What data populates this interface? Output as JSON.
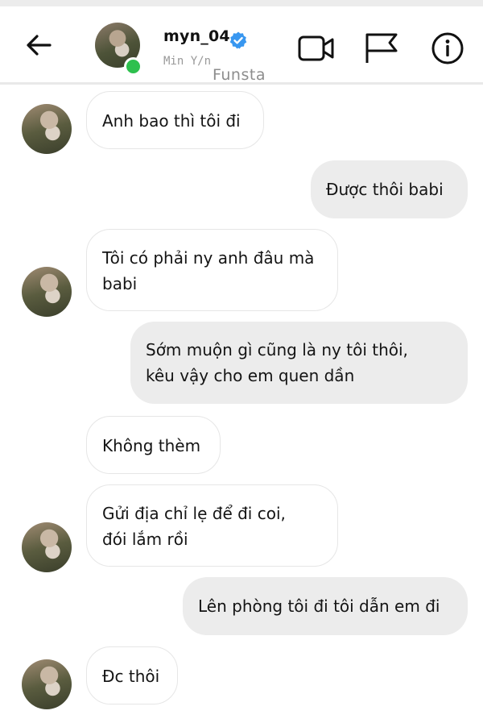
{
  "header": {
    "username": "myn_04",
    "subtitle": "Min Y/n",
    "watermark": "Funsta",
    "icons": {
      "back": "arrow-left-icon",
      "verified": "verified-badge-icon",
      "video": "video-call-icon",
      "flag": "flag-icon",
      "info": "info-icon"
    },
    "colors": {
      "verified": "#3897f0",
      "online": "#2ec04e"
    }
  },
  "messages": [
    {
      "side": "in",
      "text": "Anh bao thì tôi đi",
      "avatar": true
    },
    {
      "side": "out",
      "text": "Được thôi babi"
    },
    {
      "side": "in",
      "text": "Tôi có phải ny anh đâu mà\nbabi",
      "avatar": true
    },
    {
      "side": "out",
      "text": "Sớm muộn gì cũng là ny tôi thôi,\nkêu vậy cho em quen dần"
    },
    {
      "side": "in",
      "text": "Không thèm",
      "avatar": false
    },
    {
      "side": "in",
      "text": "Gửi địa chỉ lẹ để đi coi,\nđói lắm rồi",
      "avatar": true
    },
    {
      "side": "out",
      "text": "Lên phòng tôi đi tôi dẫn em đi"
    },
    {
      "side": "in",
      "text": "Đc thôi",
      "avatar": true
    }
  ]
}
